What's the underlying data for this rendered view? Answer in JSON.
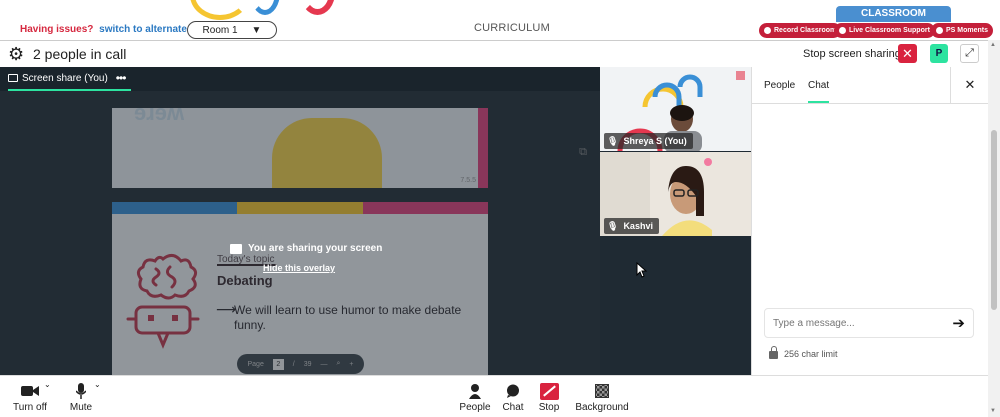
{
  "topbar": {
    "issues_text": "Having issues?",
    "alternate_link": "switch to alternate room",
    "room_select_value": "Room 1",
    "curriculum": "CURRICULUM",
    "classroom_tab": "CLASSROOM",
    "record_label": "Record Classroom",
    "support_label": "Live Classroom Support",
    "moments_label": "PS Moments"
  },
  "call": {
    "title": "2 people in call",
    "stop_sharing_label": "Stop screen sharing",
    "profile_initial": "P"
  },
  "stage": {
    "tab_label": "Screen share (You)",
    "overlay_message": "You are sharing your screen",
    "hide_overlay": "Hide this overlay",
    "slide": {
      "topic_small": "Today's topic",
      "topic_title": "Debating",
      "topic_text": "We will learn to use humor to make debate funny.",
      "top_page_label": "7.5.5",
      "page_label": "Page",
      "page_current": "2",
      "page_sep": "/",
      "page_total": "39"
    }
  },
  "participants": [
    {
      "name": "Shreya S (You)"
    },
    {
      "name": "Kashvi"
    }
  ],
  "side_panel": {
    "tabs": [
      "People",
      "Chat"
    ],
    "active_tab": "Chat",
    "message_placeholder": "Type a message...",
    "char_limit": "256 char limit"
  },
  "bottom_controls": {
    "camera": "Turn off",
    "mic": "Mute",
    "people": "People",
    "chat": "Chat",
    "stop": "Stop",
    "background": "Background"
  },
  "colors": {
    "accent_green": "#2de3a0",
    "danger_red": "#d9233f",
    "dark_stage": "#1f2a33",
    "classroom_blue": "#4a8fd0"
  }
}
